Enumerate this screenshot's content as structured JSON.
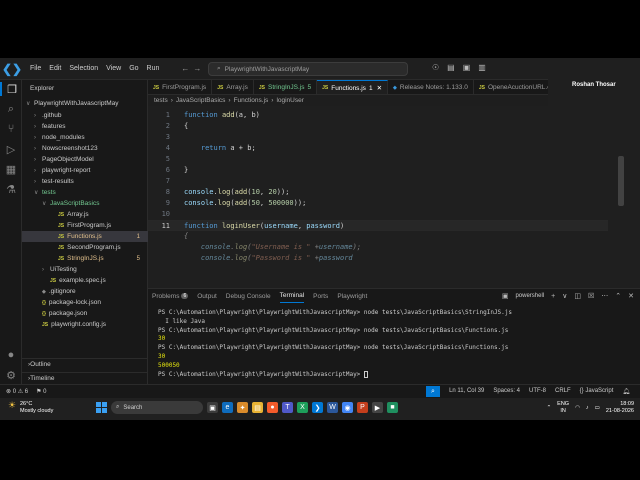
{
  "window": {
    "menu": [
      "File",
      "Edit",
      "Selection",
      "View",
      "Go",
      "Run"
    ],
    "command_center": "PlaywrightWithJavascriptMay",
    "participant_name": "Roshan Thosar"
  },
  "explorer": {
    "title": "Explorer",
    "project": "PlaywrightWithJavascriptMay",
    "items": [
      {
        "label": ".github",
        "indent": 1,
        "kind": "folder",
        "expanded": false
      },
      {
        "label": "features",
        "indent": 1,
        "kind": "folder",
        "expanded": false
      },
      {
        "label": "node_modules",
        "indent": 1,
        "kind": "folder",
        "expanded": false
      },
      {
        "label": "Nowscreenshot123",
        "indent": 1,
        "kind": "folder",
        "expanded": false
      },
      {
        "label": "PageObjectModel",
        "indent": 1,
        "kind": "folder",
        "expanded": false
      },
      {
        "label": "playwright-report",
        "indent": 1,
        "kind": "folder",
        "expanded": false
      },
      {
        "label": "test-results",
        "indent": 1,
        "kind": "folder",
        "expanded": false
      },
      {
        "label": "tests",
        "indent": 1,
        "kind": "folder",
        "expanded": true,
        "color": "green"
      },
      {
        "label": "JavaScriptBasics",
        "indent": 2,
        "kind": "folder",
        "expanded": true,
        "color": "green"
      },
      {
        "label": "Array.js",
        "indent": 3,
        "kind": "js"
      },
      {
        "label": "FirstProgram.js",
        "indent": 3,
        "kind": "js"
      },
      {
        "label": "Functions.js",
        "indent": 3,
        "kind": "js",
        "selected": true,
        "badge": "1",
        "color": "yellow"
      },
      {
        "label": "SecondProgram.js",
        "indent": 3,
        "kind": "js"
      },
      {
        "label": "StringInJS.js",
        "indent": 3,
        "kind": "js",
        "badge": "5",
        "color": "yellow"
      },
      {
        "label": "UiTesting",
        "indent": 2,
        "kind": "folder",
        "expanded": false
      },
      {
        "label": "example.spec.js",
        "indent": 2,
        "kind": "js"
      },
      {
        "label": ".gitignore",
        "indent": 1,
        "kind": "file"
      },
      {
        "label": "package-lock.json",
        "indent": 1,
        "kind": "json"
      },
      {
        "label": "package.json",
        "indent": 1,
        "kind": "json"
      },
      {
        "label": "playwright.config.js",
        "indent": 1,
        "kind": "js"
      }
    ],
    "outline": "Outline",
    "timeline": "Timeline"
  },
  "tabs": [
    {
      "label": "FirstProgram.js",
      "active": false
    },
    {
      "label": "Array.js",
      "active": false
    },
    {
      "label": "StringInJS.js",
      "active": false,
      "suffix": "5",
      "color": "green"
    },
    {
      "label": "Functions.js",
      "active": true,
      "suffix": "1"
    },
    {
      "label": "Release Notes: 1.133.0",
      "active": false
    },
    {
      "label": "OpeneAcuctionURL.e",
      "active": false
    }
  ],
  "breadcrumb": [
    "tests",
    "JavaScriptBasics",
    "Functions.js",
    "loginUser"
  ],
  "editor": {
    "lines": [
      {
        "n": "1",
        "text": "function add(a, b)"
      },
      {
        "n": "2",
        "text": "{"
      },
      {
        "n": "3",
        "text": ""
      },
      {
        "n": "4",
        "text": "    return a + b;"
      },
      {
        "n": "5",
        "text": ""
      },
      {
        "n": "6",
        "text": "}"
      },
      {
        "n": "7",
        "text": ""
      },
      {
        "n": "8",
        "text": "console.log(add(10, 20));"
      },
      {
        "n": "9",
        "text": "console.log(add(50, 500000));"
      },
      {
        "n": "10",
        "text": ""
      },
      {
        "n": "11",
        "text": "function loginUser(username, password)"
      },
      {
        "n": "",
        "text": "{"
      },
      {
        "n": "",
        "text": "    console.log(\"Username is \" +username);"
      },
      {
        "n": "",
        "text": "    console.log(\"Password is \" +password"
      }
    ]
  },
  "panel": {
    "tabs": [
      "Problems",
      "Output",
      "Debug Console",
      "Terminal",
      "Ports",
      "Playwright"
    ],
    "problems_count": "6",
    "active_tab": "Terminal",
    "shell": "powershell",
    "terminal": [
      {
        "text": "PS C:\\Automation\\Playwright\\PlaywrightWithJavascriptMay> node tests\\JavaScriptBasics\\StringInJS.js",
        "color": "normal"
      },
      {
        "text": "  I like Java",
        "color": "normal"
      },
      {
        "text": "PS C:\\Automation\\Playwright\\PlaywrightWithJavascriptMay> node tests\\JavaScriptBasics\\Functions.js",
        "color": "normal"
      },
      {
        "text": "30",
        "color": "yellow"
      },
      {
        "text": "PS C:\\Automation\\Playwright\\PlaywrightWithJavascriptMay> node tests\\JavaScriptBasics\\Functions.js",
        "color": "normal"
      },
      {
        "text": "30",
        "color": "yellow"
      },
      {
        "text": "500050",
        "color": "yellow"
      },
      {
        "text": "PS C:\\Automation\\Playwright\\PlaywrightWithJavascriptMay> ",
        "color": "normal",
        "cursor": true
      }
    ]
  },
  "statusbar": {
    "errors": "0",
    "warnings": "6",
    "ports": "0",
    "position": "Ln 11, Col 39",
    "spaces": "Spaces: 4",
    "encoding": "UTF-8",
    "eol": "CRLF",
    "language": "JavaScript"
  },
  "taskbar": {
    "temperature": "26°C",
    "weather": "Mostly cloudy",
    "search": "Search",
    "lang1": "ENG",
    "lang2": "IN",
    "time": "18:09",
    "date": "21-08-2026"
  }
}
